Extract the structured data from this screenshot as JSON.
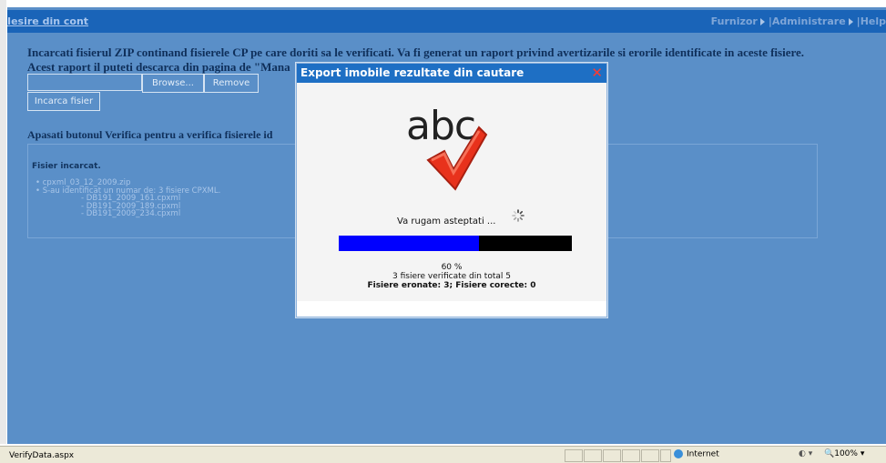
{
  "nav": {
    "logout": "Iesire din cont",
    "furnizor": "Furnizor",
    "administrare": "Administrare",
    "help": "Help"
  },
  "page": {
    "intro_line1": "Incarcati fisierul ZIP continand fisierele CP pe care doriti sa le verificati. Va fi generat un raport privind avertizarile si erorile identificate in aceste fisiere.",
    "intro_line2": "Acest raport il puteti descarca din pagina de \"Mana",
    "browse_label": "Browse...",
    "remove_label": "Remove",
    "upload_label": "Incarca fisier",
    "instruction": "Apasati butonul Verifica pentru a verifica fisierele id",
    "panel_heading": "Fisier incarcat.",
    "zip_name": "cpxml_03_12_2009.zip",
    "identified": "S-au identificat un numar de: 3 fisiere CPXML.",
    "files": [
      "DB191_2009_161.cpxml",
      "DB191_2009_189.cpxml",
      "DB191_2009_234.cpxml"
    ]
  },
  "modal": {
    "title": "Export imobile rezultate din cautare",
    "logo_text": "abc",
    "wait_text": "Va rugam asteptati ...",
    "progress_percent": 60,
    "percent_label": "60 %",
    "checked_text": "3 fisiere verificate din total 5",
    "summary_text": "Fisiere eronate: 3; Fisiere corecte: 0"
  },
  "status": {
    "url": "VerifyData.aspx",
    "zone": "Internet",
    "zoom": "100%"
  },
  "colors": {
    "background": "#5a8fc8",
    "navbar": "#1a64b8",
    "progress_fill": "#0000ff",
    "progress_track": "#000000",
    "check": "#e8321c"
  }
}
